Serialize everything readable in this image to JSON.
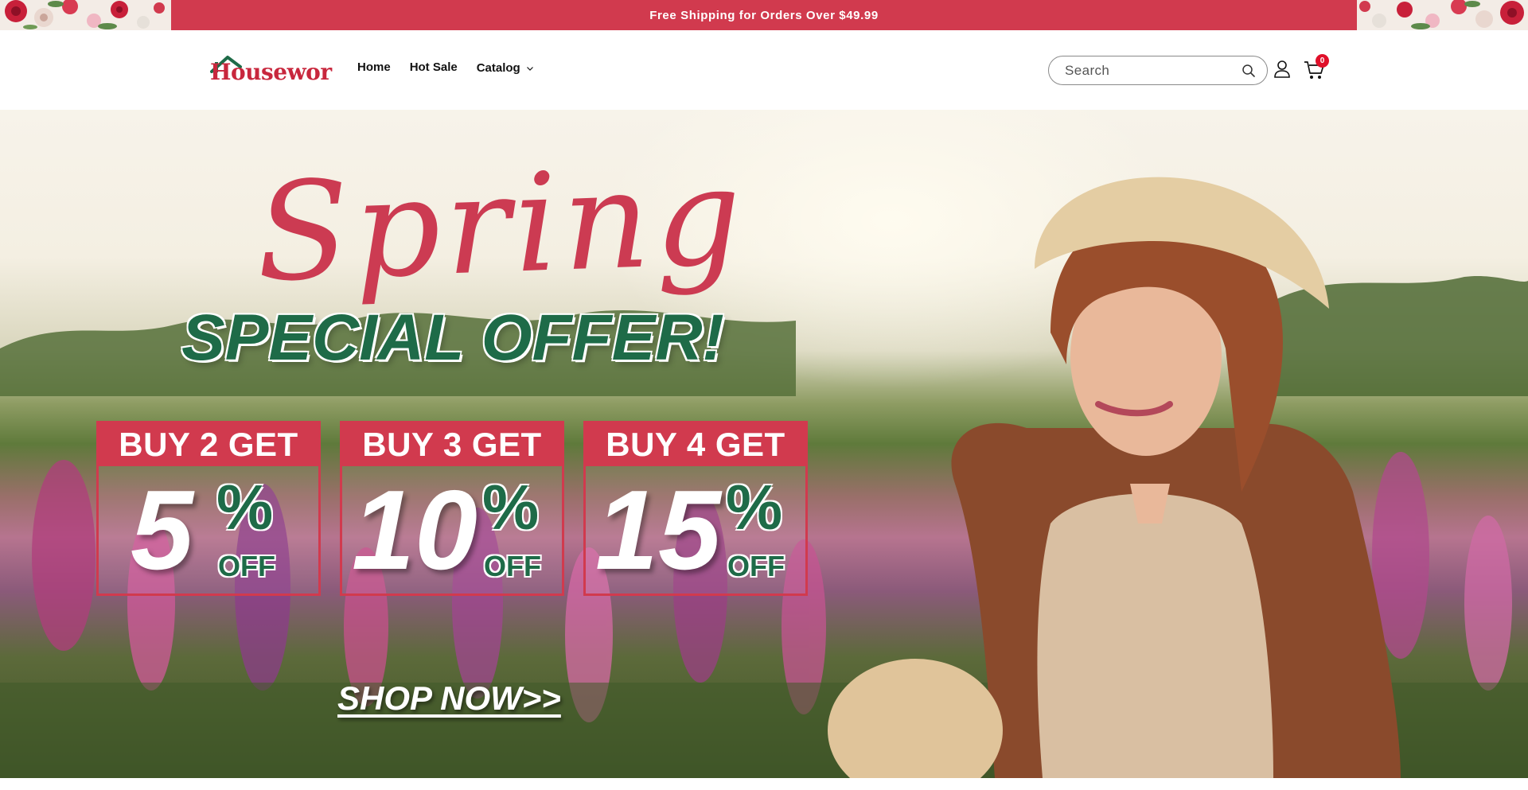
{
  "announcement": {
    "text": "Free Shipping for Orders Over $49.99"
  },
  "header": {
    "logo_text": "Housewor",
    "nav": [
      {
        "label": "Home"
      },
      {
        "label": "Hot Sale"
      },
      {
        "label": "Catalog"
      }
    ],
    "search": {
      "placeholder": "Search"
    },
    "cart_count": "0"
  },
  "hero": {
    "script_title": "Spring",
    "headline": "SPECIAL OFFER!",
    "offers": [
      {
        "heading": "BUY 2 GET",
        "number": "5",
        "percent": "%",
        "off": "OFF"
      },
      {
        "heading": "BUY 3 GET",
        "number": "10",
        "percent": "%",
        "off": "OFF"
      },
      {
        "heading": "BUY 4 GET",
        "number": "15",
        "percent": "%",
        "off": "OFF"
      }
    ],
    "cta": "SHOP NOW>>"
  },
  "colors": {
    "brand_red": "#d13a4e",
    "brand_green": "#1e6b48",
    "badge_red": "#e0102a"
  },
  "icons": [
    "search-icon",
    "account-icon",
    "cart-icon",
    "chevron-down-icon"
  ]
}
